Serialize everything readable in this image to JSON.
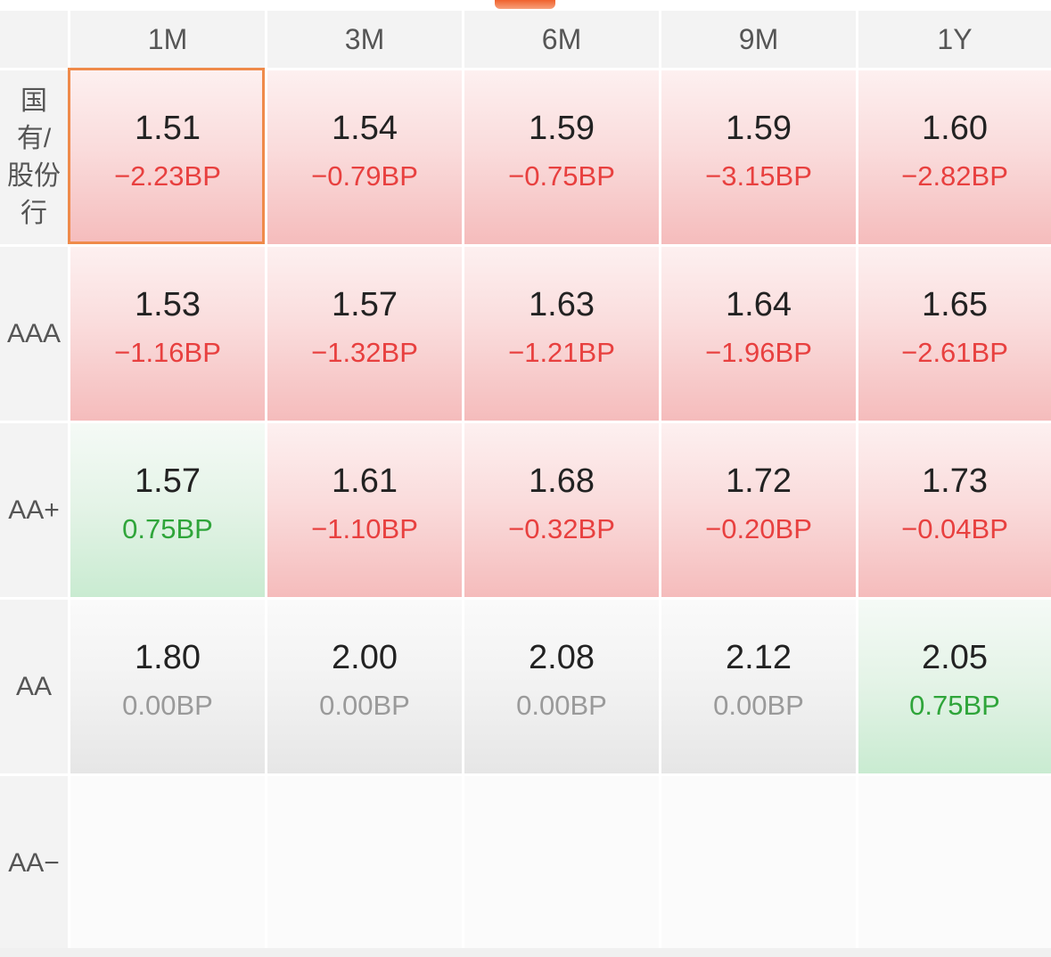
{
  "columns": [
    "1M",
    "3M",
    "6M",
    "9M",
    "1Y"
  ],
  "rows": [
    {
      "label": "国有/股份行",
      "cells": [
        {
          "rate": "1.51",
          "change": "−2.23BP",
          "trend": "red",
          "dir": "neg",
          "selected": true
        },
        {
          "rate": "1.54",
          "change": "−0.79BP",
          "trend": "red",
          "dir": "neg"
        },
        {
          "rate": "1.59",
          "change": "−0.75BP",
          "trend": "red",
          "dir": "neg"
        },
        {
          "rate": "1.59",
          "change": "−3.15BP",
          "trend": "red",
          "dir": "neg"
        },
        {
          "rate": "1.60",
          "change": "−2.82BP",
          "trend": "red",
          "dir": "neg"
        }
      ]
    },
    {
      "label": "AAA",
      "cells": [
        {
          "rate": "1.53",
          "change": "−1.16BP",
          "trend": "red",
          "dir": "neg"
        },
        {
          "rate": "1.57",
          "change": "−1.32BP",
          "trend": "red",
          "dir": "neg"
        },
        {
          "rate": "1.63",
          "change": "−1.21BP",
          "trend": "red",
          "dir": "neg"
        },
        {
          "rate": "1.64",
          "change": "−1.96BP",
          "trend": "red",
          "dir": "neg"
        },
        {
          "rate": "1.65",
          "change": "−2.61BP",
          "trend": "red",
          "dir": "neg"
        }
      ]
    },
    {
      "label": "AA+",
      "cells": [
        {
          "rate": "1.57",
          "change": "0.75BP",
          "trend": "green",
          "dir": "pos"
        },
        {
          "rate": "1.61",
          "change": "−1.10BP",
          "trend": "red",
          "dir": "neg"
        },
        {
          "rate": "1.68",
          "change": "−0.32BP",
          "trend": "red",
          "dir": "neg"
        },
        {
          "rate": "1.72",
          "change": "−0.20BP",
          "trend": "red",
          "dir": "neg"
        },
        {
          "rate": "1.73",
          "change": "−0.04BP",
          "trend": "red",
          "dir": "neg"
        }
      ]
    },
    {
      "label": "AA",
      "cells": [
        {
          "rate": "1.80",
          "change": "0.00BP",
          "trend": "gray",
          "dir": "flat"
        },
        {
          "rate": "2.00",
          "change": "0.00BP",
          "trend": "gray",
          "dir": "flat"
        },
        {
          "rate": "2.08",
          "change": "0.00BP",
          "trend": "gray",
          "dir": "flat"
        },
        {
          "rate": "2.12",
          "change": "0.00BP",
          "trend": "gray",
          "dir": "flat"
        },
        {
          "rate": "2.05",
          "change": "0.75BP",
          "trend": "green",
          "dir": "pos"
        }
      ]
    },
    {
      "label": "AA−",
      "cells": [
        {
          "rate": "",
          "change": "",
          "trend": "empty",
          "dir": "flat"
        },
        {
          "rate": "",
          "change": "",
          "trend": "empty",
          "dir": "flat"
        },
        {
          "rate": "",
          "change": "",
          "trend": "empty",
          "dir": "flat"
        },
        {
          "rate": "",
          "change": "",
          "trend": "empty",
          "dir": "flat"
        },
        {
          "rate": "",
          "change": "",
          "trend": "empty",
          "dir": "flat"
        }
      ]
    }
  ],
  "colors": {
    "negative": "#e8403f",
    "positive": "#2fa53a",
    "flat": "#9a9a9a",
    "selected_border": "#ef8a4a",
    "accent": "#f0622e"
  }
}
